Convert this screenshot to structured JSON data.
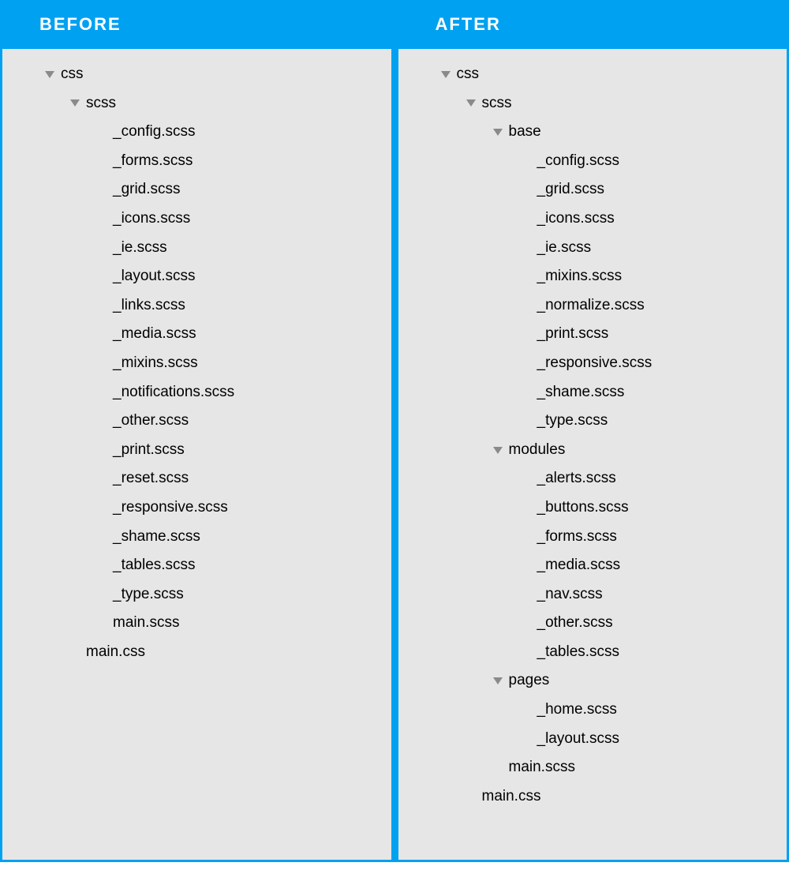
{
  "headers": {
    "before": "BEFORE",
    "after": "AFTER"
  },
  "before": {
    "nodes": [
      {
        "label": "css",
        "depth": 0,
        "folder": true
      },
      {
        "label": "scss",
        "depth": 1,
        "folder": true
      },
      {
        "label": "_config.scss",
        "depth": 2,
        "folder": false
      },
      {
        "label": "_forms.scss",
        "depth": 2,
        "folder": false
      },
      {
        "label": "_grid.scss",
        "depth": 2,
        "folder": false
      },
      {
        "label": "_icons.scss",
        "depth": 2,
        "folder": false
      },
      {
        "label": "_ie.scss",
        "depth": 2,
        "folder": false
      },
      {
        "label": "_layout.scss",
        "depth": 2,
        "folder": false
      },
      {
        "label": "_links.scss",
        "depth": 2,
        "folder": false
      },
      {
        "label": "_media.scss",
        "depth": 2,
        "folder": false
      },
      {
        "label": "_mixins.scss",
        "depth": 2,
        "folder": false
      },
      {
        "label": "_notifications.scss",
        "depth": 2,
        "folder": false
      },
      {
        "label": "_other.scss",
        "depth": 2,
        "folder": false
      },
      {
        "label": "_print.scss",
        "depth": 2,
        "folder": false
      },
      {
        "label": "_reset.scss",
        "depth": 2,
        "folder": false
      },
      {
        "label": "_responsive.scss",
        "depth": 2,
        "folder": false
      },
      {
        "label": "_shame.scss",
        "depth": 2,
        "folder": false
      },
      {
        "label": "_tables.scss",
        "depth": 2,
        "folder": false
      },
      {
        "label": "_type.scss",
        "depth": 2,
        "folder": false
      },
      {
        "label": "main.scss",
        "depth": 2,
        "folder": false
      },
      {
        "label": "main.css",
        "depth": 1,
        "folder": false
      }
    ]
  },
  "after": {
    "nodes": [
      {
        "label": "css",
        "depth": 0,
        "folder": true
      },
      {
        "label": "scss",
        "depth": 1,
        "folder": true
      },
      {
        "label": "base",
        "depth": 2,
        "folder": true
      },
      {
        "label": "_config.scss",
        "depth": 3,
        "folder": false
      },
      {
        "label": "_grid.scss",
        "depth": 3,
        "folder": false
      },
      {
        "label": "_icons.scss",
        "depth": 3,
        "folder": false
      },
      {
        "label": "_ie.scss",
        "depth": 3,
        "folder": false
      },
      {
        "label": "_mixins.scss",
        "depth": 3,
        "folder": false
      },
      {
        "label": "_normalize.scss",
        "depth": 3,
        "folder": false
      },
      {
        "label": "_print.scss",
        "depth": 3,
        "folder": false
      },
      {
        "label": "_responsive.scss",
        "depth": 3,
        "folder": false
      },
      {
        "label": "_shame.scss",
        "depth": 3,
        "folder": false
      },
      {
        "label": "_type.scss",
        "depth": 3,
        "folder": false
      },
      {
        "label": "modules",
        "depth": 2,
        "folder": true
      },
      {
        "label": "_alerts.scss",
        "depth": 3,
        "folder": false
      },
      {
        "label": "_buttons.scss",
        "depth": 3,
        "folder": false
      },
      {
        "label": "_forms.scss",
        "depth": 3,
        "folder": false
      },
      {
        "label": "_media.scss",
        "depth": 3,
        "folder": false
      },
      {
        "label": "_nav.scss",
        "depth": 3,
        "folder": false
      },
      {
        "label": "_other.scss",
        "depth": 3,
        "folder": false
      },
      {
        "label": "_tables.scss",
        "depth": 3,
        "folder": false
      },
      {
        "label": "pages",
        "depth": 2,
        "folder": true
      },
      {
        "label": "_home.scss",
        "depth": 3,
        "folder": false
      },
      {
        "label": "_layout.scss",
        "depth": 3,
        "folder": false
      },
      {
        "label": "main.scss",
        "depth": 2,
        "folder": false
      },
      {
        "label": "main.css",
        "depth": 1,
        "folder": false
      }
    ]
  }
}
